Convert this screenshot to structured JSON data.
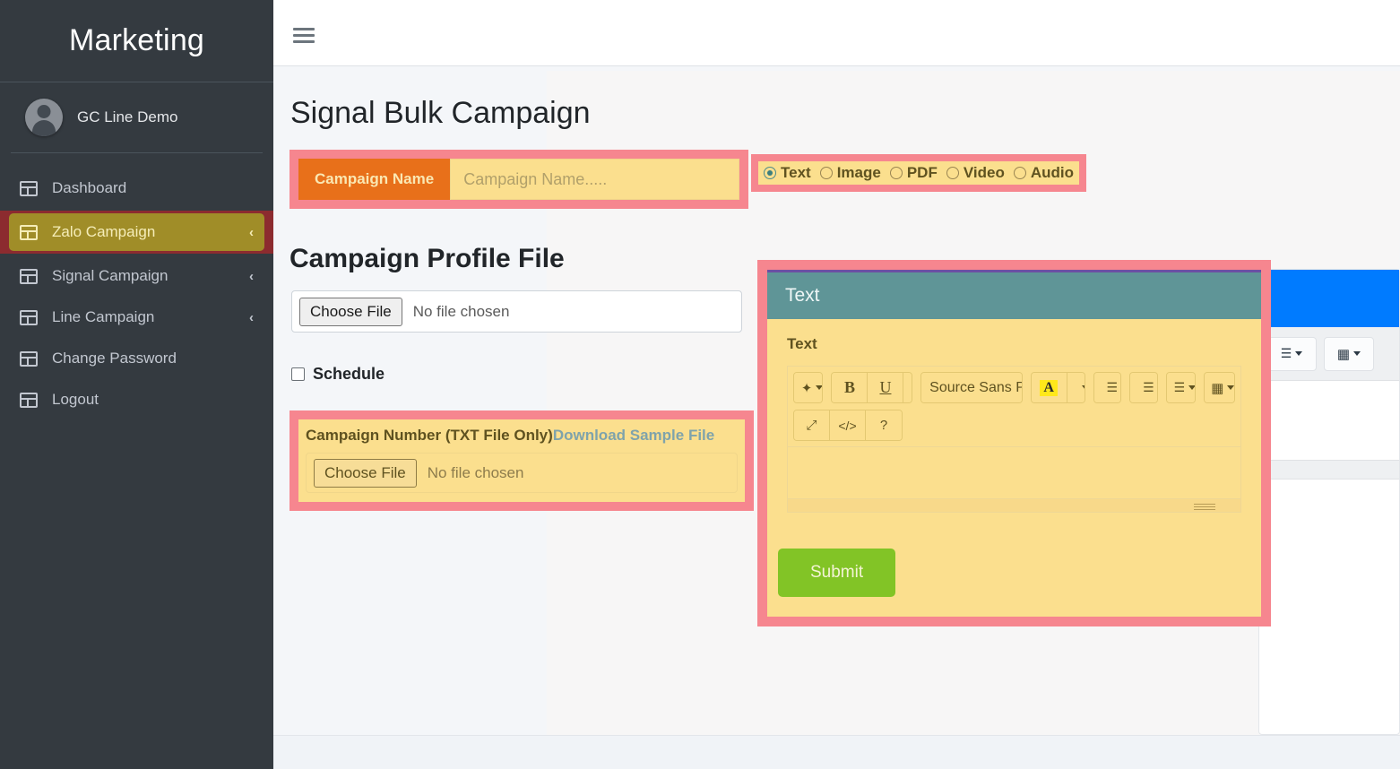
{
  "sidebar": {
    "brand": "Marketing",
    "user": {
      "name": "GC Line Demo",
      "avatar_icon": "user-avatar-icon"
    },
    "items": [
      {
        "label": "Dashboard",
        "icon": "table-icon",
        "chevron": "",
        "active": false
      },
      {
        "label": "Zalo Campaign",
        "icon": "table-icon",
        "chevron": "‹",
        "active": true
      },
      {
        "label": "Signal Campaign",
        "icon": "table-icon",
        "chevron": "‹",
        "active": false
      },
      {
        "label": "Line Campaign",
        "icon": "table-icon",
        "chevron": "‹",
        "active": false
      },
      {
        "label": "Change Password",
        "icon": "table-icon",
        "chevron": "",
        "active": false
      },
      {
        "label": "Logout",
        "icon": "table-icon",
        "chevron": "",
        "active": false
      }
    ]
  },
  "navbar": {
    "menu_icon": "hamburger-icon"
  },
  "page": {
    "title": "Signal Bulk Campaign"
  },
  "campaign_name": {
    "prefix_label": "Campaign Name",
    "value": "",
    "placeholder": "Campaign Name....."
  },
  "media_type": {
    "options": [
      {
        "label": "Text",
        "selected": true
      },
      {
        "label": "Image",
        "selected": false
      },
      {
        "label": "PDF",
        "selected": false
      },
      {
        "label": "Video",
        "selected": false
      },
      {
        "label": "Audio",
        "selected": false
      }
    ]
  },
  "profile_file": {
    "section_title": "Campaign Profile File",
    "choose_label": "Choose File",
    "status": "No file chosen"
  },
  "schedule": {
    "label": "Schedule",
    "checked": false
  },
  "campaign_number": {
    "label": "Campaign Number (TXT File Only)",
    "download_link": "Download Sample File",
    "choose_label": "Choose File",
    "status": "No file chosen"
  },
  "editor_card": {
    "header_title": "Text",
    "field_label": "Text",
    "content": "",
    "toolbar": {
      "row1": [
        {
          "group": [
            {
              "icon": "magic-wand-icon",
              "glyph": "✦",
              "caret": true
            }
          ]
        },
        {
          "group": [
            {
              "icon": "bold-icon",
              "glyph": "B",
              "caret": false
            },
            {
              "icon": "underline-icon",
              "glyph": "U",
              "caret": false
            },
            {
              "icon": "eraser-icon",
              "glyph": "◨",
              "caret": false
            }
          ]
        },
        {
          "group": [
            {
              "icon": "font-family-dropdown",
              "glyph": "Source Sans Pro",
              "caret": true
            }
          ]
        },
        {
          "group": [
            {
              "icon": "font-color-icon",
              "glyph": "A",
              "caret": false
            },
            {
              "icon": "font-color-dropdown",
              "glyph": "",
              "caret": true
            }
          ]
        },
        {
          "group": [
            {
              "icon": "unordered-list-icon",
              "glyph": "☰",
              "caret": false
            }
          ]
        },
        {
          "group": [
            {
              "icon": "ordered-list-icon",
              "glyph": "☰",
              "caret": false
            }
          ]
        },
        {
          "group": [
            {
              "icon": "paragraph-align-icon",
              "glyph": "☰",
              "caret": true
            }
          ]
        },
        {
          "group": [
            {
              "icon": "table-insert-icon",
              "glyph": "▦",
              "caret": true
            }
          ]
        }
      ],
      "row2": [
        {
          "group": [
            {
              "icon": "fullscreen-icon",
              "glyph": "⤢",
              "caret": false
            },
            {
              "icon": "code-view-icon",
              "glyph": "</>",
              "caret": false
            },
            {
              "icon": "help-icon",
              "glyph": "?",
              "caret": false
            }
          ]
        }
      ]
    },
    "submit_label": "Submit"
  },
  "colors": {
    "sidebar_bg": "#343a40",
    "highlight_border": "#f6868f",
    "highlight_fill": "#fbdf8e",
    "active_nav_bg": "#a08d28",
    "active_nav_border": "#8c2b2f",
    "prefix_orange": "#e8701a",
    "editor_header_teal": "#5f9597",
    "submit_green": "#82c426",
    "link_blue_gray": "#7fa3ab",
    "blue_card": "#007bff"
  }
}
